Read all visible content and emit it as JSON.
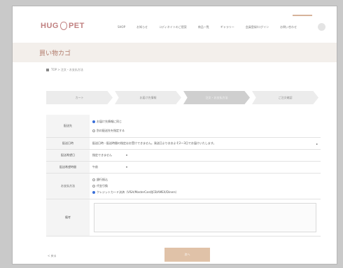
{
  "logo": {
    "part1": "HUG",
    "part2": "PET"
  },
  "nav": [
    "SHOP",
    "お知らせ",
    "コディネイトのご提案",
    "商品一覧",
    "ギャラリー",
    "会員登録/ログイン",
    "お問い合わせ"
  ],
  "page": {
    "title": "買い物カゴ"
  },
  "breadcrumb": {
    "text": "TOP > 注文・お支払方法"
  },
  "steps": [
    "カート",
    "お届け先情報",
    "注文・お支払方法",
    "ご注文確認"
  ],
  "form": {
    "delivery": {
      "label": "配送先",
      "opt1": "お届け先情報に同じ",
      "opt2": "別の配送先を指定する"
    },
    "note": {
      "label": "配送日時",
      "text": "配送日時・配送時間の指定はお受けできません。発送日よりおおよそ2〜3日でお届けいたします。",
      "mark": "▸"
    },
    "date": {
      "label": "配送希望日",
      "value": "指定できません",
      "arrow": "▾"
    },
    "time": {
      "label": "配送希望時間",
      "value": "午前",
      "arrow": "▾"
    },
    "payment": {
      "label": "お支払方法",
      "opt1": "銀行振込",
      "opt2": "代金引換",
      "opt3": "クレジットカード決済（VISA/MasterCard/JCB/AMEX/Diners）"
    },
    "remarks": {
      "label": "備考"
    }
  },
  "footer": {
    "back": "< 戻る",
    "next": "次へ"
  }
}
